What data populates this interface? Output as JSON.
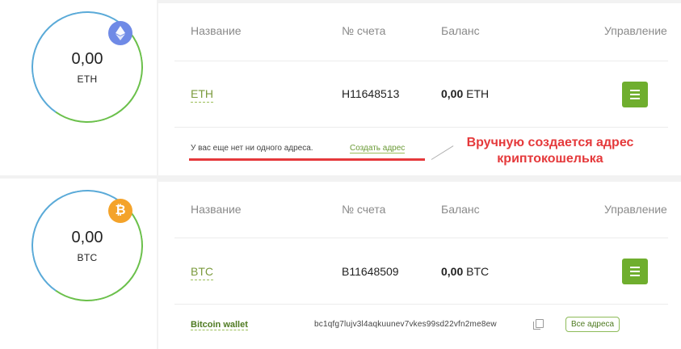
{
  "eth_card": {
    "ring": {
      "value": "0,00",
      "currency": "ETH"
    },
    "coin_icon": "ethereum-icon",
    "headers": {
      "name": "Название",
      "account": "№ счета",
      "balance": "Баланс",
      "manage": "Управление"
    },
    "row": {
      "name": "ETH",
      "account": "H11648513",
      "balance_value": "0,00",
      "balance_currency": "ETH"
    },
    "no_address_text": "У вас еще нет ни одного адреса.",
    "create_address_link": "Создать адрес"
  },
  "annotation": {
    "line1": "Вручную создается адрес",
    "line2": "криптокошелька",
    "color": "#e5393b"
  },
  "btc_card": {
    "ring": {
      "value": "0,00",
      "currency": "BTC"
    },
    "coin_icon": "bitcoin-icon",
    "coin_glyph": "₿",
    "headers": {
      "name": "Название",
      "account": "№ счета",
      "balance": "Баланс",
      "manage": "Управление"
    },
    "row": {
      "name": "BTC",
      "account": "B11648509",
      "balance_value": "0,00",
      "balance_currency": "BTC"
    },
    "wallet": {
      "name": "Bitcoin wallet",
      "address": "bc1qfg7lujv3l4aqkuunev7vkes99sd22vfn2me8ew",
      "all_addresses_button": "Все адреса"
    }
  },
  "colors": {
    "accent_green": "#6fae2e",
    "eth_blue": "#6f8ae6",
    "btc_orange": "#f4a32a"
  }
}
